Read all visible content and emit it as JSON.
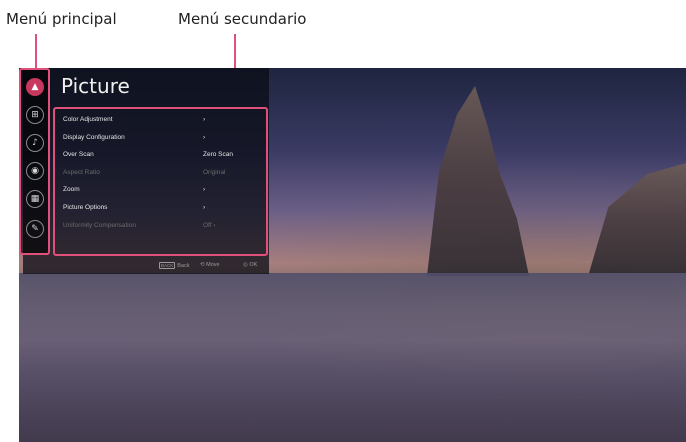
{
  "annotations": {
    "main_menu_label": "Menú principal",
    "secondary_menu_label": "Menú secundario"
  },
  "sidebar": {
    "items": [
      {
        "icon": "picture-icon",
        "glyph": "▲",
        "active": true
      },
      {
        "icon": "screen-icon",
        "glyph": "⊞",
        "active": false
      },
      {
        "icon": "sound-icon",
        "glyph": "♪",
        "active": false
      },
      {
        "icon": "network-icon",
        "glyph": "◉",
        "active": false
      },
      {
        "icon": "general-icon",
        "glyph": "▦",
        "active": false
      },
      {
        "icon": "settings-icon",
        "glyph": "✎",
        "active": false
      }
    ]
  },
  "panel": {
    "title": "Picture",
    "items": [
      {
        "label": "Color Adjustment",
        "value": "›",
        "disabled": false
      },
      {
        "label": "Display Configuration",
        "value": "›",
        "disabled": false
      },
      {
        "label": "Over Scan",
        "value": "Zero Scan",
        "disabled": false
      },
      {
        "label": "Aspect Ratio",
        "value": "Original",
        "disabled": true
      },
      {
        "label": "Zoom",
        "value": "›",
        "disabled": false
      },
      {
        "label": "Picture Options",
        "value": "›",
        "disabled": false
      },
      {
        "label": "Uniformity Compensation",
        "value": "Off  ›",
        "disabled": true
      }
    ]
  },
  "footer": {
    "back_key": "BACK",
    "back_label": "Back",
    "move_label": "Move",
    "ok_label": "OK"
  },
  "colors": {
    "accent": "#e0507b",
    "active_icon": "#c8385e"
  }
}
